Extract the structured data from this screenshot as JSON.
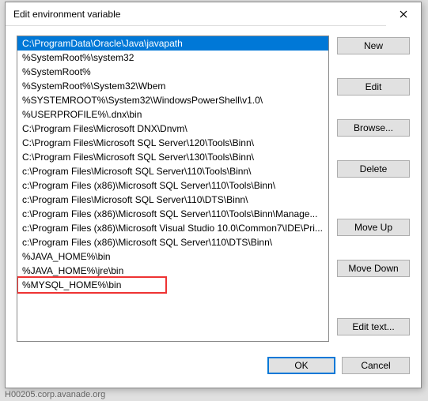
{
  "dialog": {
    "title": "Edit environment variable"
  },
  "list": {
    "selectedIndex": 0,
    "highlightIndex": 17,
    "items": [
      "C:\\ProgramData\\Oracle\\Java\\javapath",
      "%SystemRoot%\\system32",
      "%SystemRoot%",
      "%SystemRoot%\\System32\\Wbem",
      "%SYSTEMROOT%\\System32\\WindowsPowerShell\\v1.0\\",
      "%USERPROFILE%\\.dnx\\bin",
      "C:\\Program Files\\Microsoft DNX\\Dnvm\\",
      "C:\\Program Files\\Microsoft SQL Server\\120\\Tools\\Binn\\",
      "C:\\Program Files\\Microsoft SQL Server\\130\\Tools\\Binn\\",
      "c:\\Program Files\\Microsoft SQL Server\\110\\Tools\\Binn\\",
      "c:\\Program Files (x86)\\Microsoft SQL Server\\110\\Tools\\Binn\\",
      "c:\\Program Files\\Microsoft SQL Server\\110\\DTS\\Binn\\",
      "c:\\Program Files (x86)\\Microsoft SQL Server\\110\\Tools\\Binn\\Manage...",
      "c:\\Program Files (x86)\\Microsoft Visual Studio 10.0\\Common7\\IDE\\Pri...",
      "c:\\Program Files (x86)\\Microsoft SQL Server\\110\\DTS\\Binn\\",
      "%JAVA_HOME%\\bin",
      "%JAVA_HOME%\\jre\\bin",
      "%MYSQL_HOME%\\bin"
    ]
  },
  "buttons": {
    "new": "New",
    "edit": "Edit",
    "browse": "Browse...",
    "delete": "Delete",
    "moveUp": "Move Up",
    "moveDown": "Move Down",
    "editText": "Edit text...",
    "ok": "OK",
    "cancel": "Cancel"
  },
  "background_hint": "H00205.corp.avanade.org"
}
